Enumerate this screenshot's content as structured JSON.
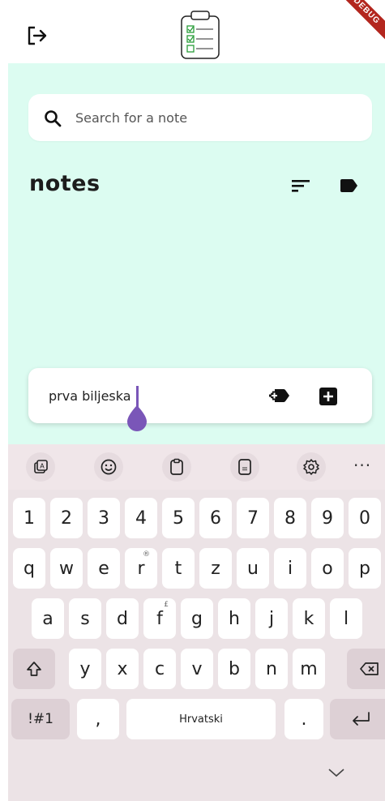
{
  "app": {
    "debug_banner": "DEBUG",
    "logout_icon": "logout-icon",
    "logo_icon": "clipboard-checklist-icon"
  },
  "search": {
    "placeholder": "Search for a note",
    "icon": "search-icon"
  },
  "notes": {
    "title": "notes",
    "sort_icon": "sort-icon",
    "label_icon": "label-icon"
  },
  "composer": {
    "value": "prva biljeska",
    "add_label_icon": "new-label-icon",
    "add_icon": "add-box-icon",
    "caret_color": "#7a56b8"
  },
  "keyboard": {
    "toolbar": [
      "sticker-icon",
      "emoji-icon",
      "clipboard-icon",
      "keyboard-layout-icon",
      "settings-icon"
    ],
    "toolbar_more": "···",
    "number_row": [
      "1",
      "2",
      "3",
      "4",
      "5",
      "6",
      "7",
      "8",
      "9",
      "0"
    ],
    "row1": [
      "q",
      "w",
      "e",
      "r",
      "t",
      "z",
      "u",
      "i",
      "o",
      "p"
    ],
    "row1_sup": {
      "r": "®"
    },
    "row2": [
      "a",
      "s",
      "d",
      "f",
      "g",
      "h",
      "j",
      "k",
      "l"
    ],
    "row2_sup": {
      "f": "£"
    },
    "row3": [
      "y",
      "x",
      "c",
      "v",
      "b",
      "n",
      "m"
    ],
    "shift_icon": "shift-icon",
    "backspace_icon": "backspace-icon",
    "symbols_label": "!#1",
    "comma_label": ",",
    "space_label": "Hrvatski",
    "period_label": ".",
    "enter_icon": "enter-icon",
    "hide_icon": "chevron-down-icon"
  },
  "colors": {
    "background": "#dcfcf1",
    "keyboard": "#ece3e6",
    "accent": "#7a56b8",
    "debug": "#b3261e"
  }
}
